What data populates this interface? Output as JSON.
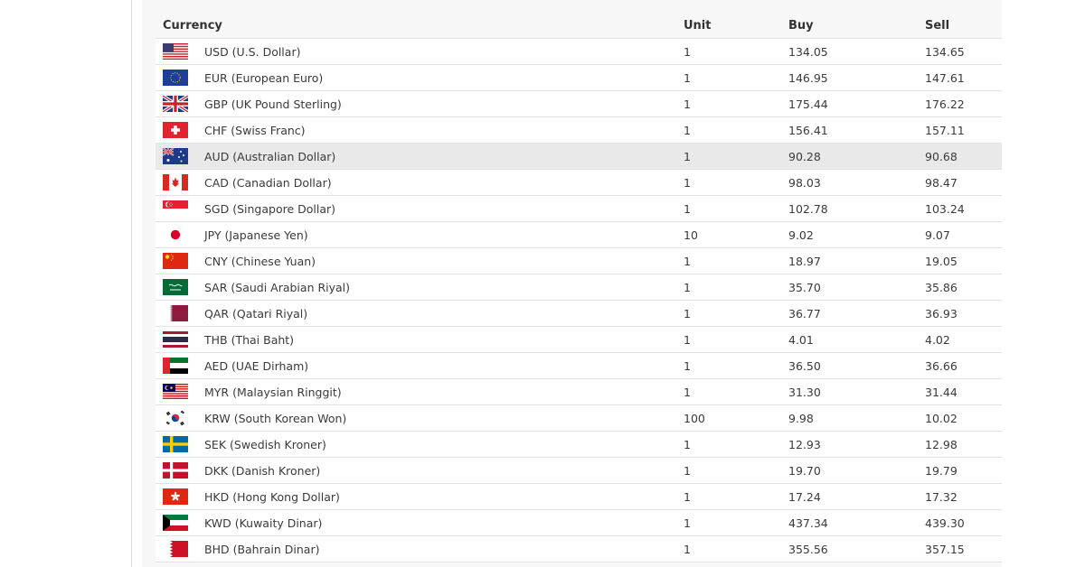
{
  "table": {
    "headers": {
      "currency": "Currency",
      "unit": "Unit",
      "buy": "Buy",
      "sell": "Sell"
    },
    "rows": [
      {
        "flag": "us-flag-icon",
        "currency": "USD (U.S. Dollar)",
        "unit": "1",
        "buy": "134.05",
        "sell": "134.65"
      },
      {
        "flag": "eu-flag-icon",
        "currency": "EUR (European Euro)",
        "unit": "1",
        "buy": "146.95",
        "sell": "147.61"
      },
      {
        "flag": "gb-flag-icon",
        "currency": "GBP (UK Pound Sterling)",
        "unit": "1",
        "buy": "175.44",
        "sell": "176.22"
      },
      {
        "flag": "ch-flag-icon",
        "currency": "CHF (Swiss Franc)",
        "unit": "1",
        "buy": "156.41",
        "sell": "157.11"
      },
      {
        "flag": "au-flag-icon",
        "currency": "AUD (Australian Dollar)",
        "unit": "1",
        "buy": "90.28",
        "sell": "90.68",
        "highlighted": true
      },
      {
        "flag": "ca-flag-icon",
        "currency": "CAD (Canadian Dollar)",
        "unit": "1",
        "buy": "98.03",
        "sell": "98.47"
      },
      {
        "flag": "sg-flag-icon",
        "currency": "SGD (Singapore Dollar)",
        "unit": "1",
        "buy": "102.78",
        "sell": "103.24"
      },
      {
        "flag": "jp-flag-icon",
        "currency": "JPY (Japanese Yen)",
        "unit": "10",
        "buy": "9.02",
        "sell": "9.07"
      },
      {
        "flag": "cn-flag-icon",
        "currency": "CNY (Chinese Yuan)",
        "unit": "1",
        "buy": "18.97",
        "sell": "19.05"
      },
      {
        "flag": "sa-flag-icon",
        "currency": "SAR (Saudi Arabian Riyal)",
        "unit": "1",
        "buy": "35.70",
        "sell": "35.86"
      },
      {
        "flag": "qa-flag-icon",
        "currency": "QAR (Qatari Riyal)",
        "unit": "1",
        "buy": "36.77",
        "sell": "36.93"
      },
      {
        "flag": "th-flag-icon",
        "currency": "THB (Thai Baht)",
        "unit": "1",
        "buy": "4.01",
        "sell": "4.02"
      },
      {
        "flag": "ae-flag-icon",
        "currency": "AED (UAE Dirham)",
        "unit": "1",
        "buy": "36.50",
        "sell": "36.66"
      },
      {
        "flag": "my-flag-icon",
        "currency": "MYR (Malaysian Ringgit)",
        "unit": "1",
        "buy": "31.30",
        "sell": "31.44"
      },
      {
        "flag": "kr-flag-icon",
        "currency": "KRW (South Korean Won)",
        "unit": "100",
        "buy": "9.98",
        "sell": "10.02"
      },
      {
        "flag": "se-flag-icon",
        "currency": "SEK (Swedish Kroner)",
        "unit": "1",
        "buy": "12.93",
        "sell": "12.98"
      },
      {
        "flag": "dk-flag-icon",
        "currency": "DKK (Danish Kroner)",
        "unit": "1",
        "buy": "19.70",
        "sell": "19.79"
      },
      {
        "flag": "hk-flag-icon",
        "currency": "HKD (Hong Kong Dollar)",
        "unit": "1",
        "buy": "17.24",
        "sell": "17.32"
      },
      {
        "flag": "kw-flag-icon",
        "currency": "KWD (Kuwaity Dinar)",
        "unit": "1",
        "buy": "437.34",
        "sell": "439.30"
      },
      {
        "flag": "bh-flag-icon",
        "currency": "BHD (Bahrain Dinar)",
        "unit": "1",
        "buy": "355.56",
        "sell": "357.15"
      }
    ]
  },
  "colors": {
    "row_highlight": "#e9e9e9",
    "panel_background": "#f7f7f7",
    "divider": "#e3e3e3"
  }
}
